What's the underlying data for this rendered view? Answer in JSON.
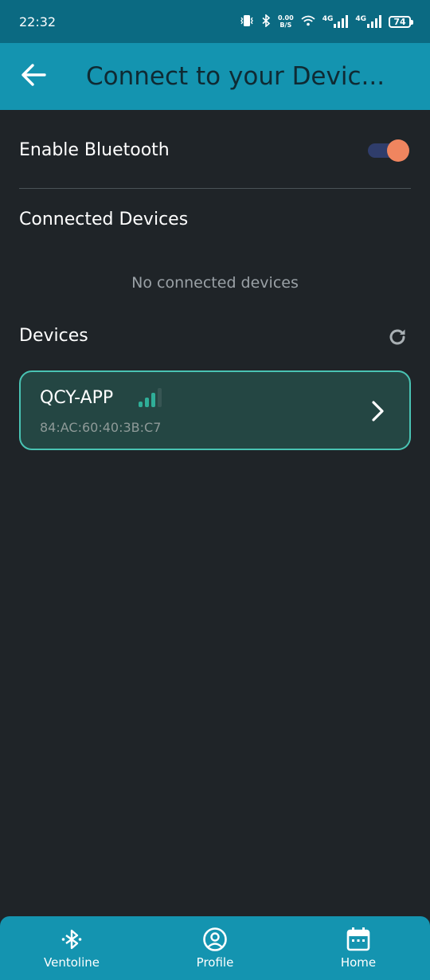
{
  "status_bar": {
    "time": "22:32",
    "net_speed_value": "0.00",
    "net_speed_unit": "B/S",
    "network1": "4G",
    "network2": "4G",
    "battery": "74"
  },
  "app_bar": {
    "title": "Connect to your Devic...",
    "back_icon": "arrow-left-icon"
  },
  "bluetooth": {
    "label": "Enable Bluetooth",
    "enabled": true
  },
  "connected_section": {
    "title": "Connected Devices",
    "empty_text": "No connected devices"
  },
  "devices_section": {
    "title": "Devices",
    "refresh_icon": "refresh-icon",
    "items": [
      {
        "name": "QCY-APP",
        "mac": "84:AC:60:40:3B:C7",
        "signal_level": 3,
        "signal_max": 4
      }
    ]
  },
  "bottom_nav": {
    "items": [
      {
        "label": "Ventoline",
        "icon": "bluetooth-icon"
      },
      {
        "label": "Profile",
        "icon": "profile-icon"
      },
      {
        "label": "Home",
        "icon": "calendar-icon"
      }
    ]
  },
  "colors": {
    "status_bar": "#0b6a82",
    "app_bar": "#1494b0",
    "background": "#1f2428",
    "toggle_knob": "#f0855f",
    "card_border": "#49c3b3",
    "signal_active": "#2fae98"
  }
}
